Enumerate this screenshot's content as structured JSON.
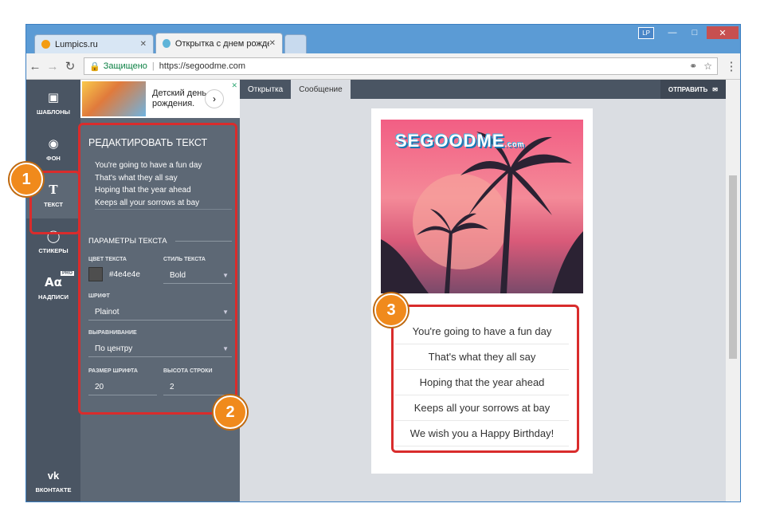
{
  "browser": {
    "tabs": [
      {
        "title": "Lumpics.ru"
      },
      {
        "title": "Открытка с днем рожде..."
      }
    ],
    "profile": "LP",
    "secure_label": "Защищено",
    "url": "https://segoodme.com"
  },
  "sidebar": {
    "items": [
      {
        "label": "ШАБЛОНЫ",
        "icon": "template-icon"
      },
      {
        "label": "ФОН",
        "icon": "background-icon"
      },
      {
        "label": "ТЕКСТ",
        "icon": "text-icon"
      },
      {
        "label": "СТИКЕРЫ",
        "icon": "sticker-icon"
      },
      {
        "label": "НАДПИСИ",
        "icon": "caption-icon"
      }
    ],
    "pro_badge": "PRO",
    "vk_label": "ВКОНТАКТЕ"
  },
  "ad": {
    "text": "Детский день рождения."
  },
  "editor": {
    "title": "РЕДАКТИРОВАТЬ ТЕКСТ",
    "lines": [
      "You're going to have a fun day",
      "That's what they all say",
      "Hoping that the year ahead",
      "Keeps all your sorrows at bay",
      "We wish you a Happy Birthday!"
    ],
    "params_title": "ПАРАМЕТРЫ ТЕКСТА",
    "color_label": "ЦВЕТ ТЕКСТА",
    "color_value": "#4e4e4e",
    "style_label": "СТИЛЬ ТЕКСТА",
    "style_value": "Bold",
    "font_label": "ШРИФТ",
    "font_value": "Plainot",
    "align_label": "ВЫРАВНИВАНИЕ",
    "align_value": "По центру",
    "size_label": "РАЗМЕР ШРИФТА",
    "size_value": "20",
    "lineheight_label": "ВЫСОТА СТРОКИ",
    "lineheight_value": "2"
  },
  "content": {
    "tabs": [
      "Открытка",
      "Сообщение"
    ],
    "send_label": "ОТПРАВИТЬ",
    "logo_text": "SEGOODME",
    "logo_sub": ".com"
  },
  "annotations": [
    "1",
    "2",
    "3"
  ],
  "colors": {
    "highlight": "#d92c2c",
    "badge": "#f08a1c",
    "panel": "#5d6875"
  }
}
